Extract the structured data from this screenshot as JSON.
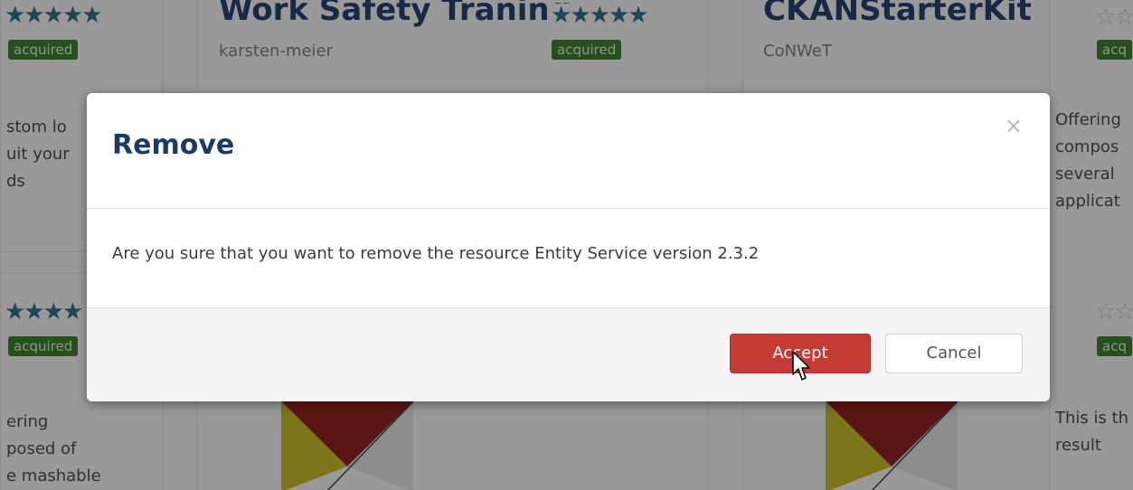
{
  "background": {
    "cards": [
      {
        "title": "Work Safety Traning",
        "author": "karsten-meier",
        "badge": "acquired"
      },
      {
        "title": "CKANStarterKit",
        "author": "CoNWeT",
        "badge": "acquired"
      }
    ],
    "left_column": {
      "badge_top": "acquired",
      "badge_bottom": "acquired",
      "desc_top": "stom lo\nuit your\nds",
      "desc_bottom": "ering\nposed of\ne mashable"
    },
    "right_column": {
      "badge_top": "acq",
      "badge_bottom": "acq",
      "desc_top": "Offering\ncompos\nseveral\napplicat",
      "desc_bottom": "This is th\nresult"
    },
    "colors": {
      "badge": "#3a7a2c",
      "star": "#2f6d7e"
    }
  },
  "modal": {
    "title": "Remove",
    "close_glyph": "×",
    "message": "Are you sure that you want to remove the resource Entity Service version 2.3.2",
    "accept_label": "Accept",
    "cancel_label": "Cancel",
    "accept_color": "#c53b34"
  }
}
